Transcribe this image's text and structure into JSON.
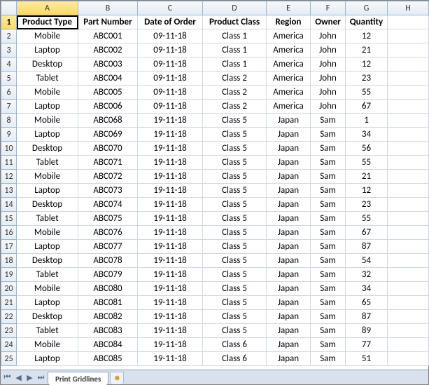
{
  "columns": [
    "A",
    "B",
    "C",
    "D",
    "E",
    "F",
    "G",
    "H"
  ],
  "active_column": "A",
  "active_row": 1,
  "headers": [
    "Product Type",
    "Part Number",
    "Date of Order",
    "Product Class",
    "Region",
    "Owner",
    "Quantity"
  ],
  "rows": [
    {
      "n": 1
    },
    {
      "n": 2,
      "c": [
        "Mobile",
        "ABC001",
        "09-11-18",
        "Class 1",
        "America",
        "John",
        "12"
      ]
    },
    {
      "n": 3,
      "c": [
        "Laptop",
        "ABC002",
        "09-11-18",
        "Class 1",
        "America",
        "John",
        "21"
      ]
    },
    {
      "n": 4,
      "c": [
        "Desktop",
        "ABC003",
        "09-11-18",
        "Class 1",
        "America",
        "John",
        "12"
      ]
    },
    {
      "n": 5,
      "c": [
        "Tablet",
        "ABC004",
        "09-11-18",
        "Class 2",
        "America",
        "John",
        "23"
      ]
    },
    {
      "n": 6,
      "c": [
        "Mobile",
        "ABC005",
        "09-11-18",
        "Class 2",
        "America",
        "John",
        "55"
      ]
    },
    {
      "n": 7,
      "c": [
        "Laptop",
        "ABC006",
        "09-11-18",
        "Class 2",
        "America",
        "John",
        "67"
      ]
    },
    {
      "n": 8,
      "c": [
        "Mobile",
        "ABC068",
        "19-11-18",
        "Class 5",
        "Japan",
        "Sam",
        "1"
      ]
    },
    {
      "n": 9,
      "c": [
        "Laptop",
        "ABC069",
        "19-11-18",
        "Class 5",
        "Japan",
        "Sam",
        "34"
      ]
    },
    {
      "n": 10,
      "c": [
        "Desktop",
        "ABC070",
        "19-11-18",
        "Class 5",
        "Japan",
        "Sam",
        "56"
      ]
    },
    {
      "n": 11,
      "c": [
        "Tablet",
        "ABC071",
        "19-11-18",
        "Class 5",
        "Japan",
        "Sam",
        "55"
      ]
    },
    {
      "n": 12,
      "c": [
        "Mobile",
        "ABC072",
        "19-11-18",
        "Class 5",
        "Japan",
        "Sam",
        "21"
      ]
    },
    {
      "n": 13,
      "c": [
        "Laptop",
        "ABC073",
        "19-11-18",
        "Class 5",
        "Japan",
        "Sam",
        "12"
      ]
    },
    {
      "n": 14,
      "c": [
        "Desktop",
        "ABC074",
        "19-11-18",
        "Class 5",
        "Japan",
        "Sam",
        "23"
      ]
    },
    {
      "n": 15,
      "c": [
        "Tablet",
        "ABC075",
        "19-11-18",
        "Class 5",
        "Japan",
        "Sam",
        "55"
      ]
    },
    {
      "n": 16,
      "c": [
        "Mobile",
        "ABC076",
        "19-11-18",
        "Class 5",
        "Japan",
        "Sam",
        "67"
      ]
    },
    {
      "n": 17,
      "c": [
        "Laptop",
        "ABC077",
        "19-11-18",
        "Class 5",
        "Japan",
        "Sam",
        "87"
      ]
    },
    {
      "n": 18,
      "c": [
        "Desktop",
        "ABC078",
        "19-11-18",
        "Class 5",
        "Japan",
        "Sam",
        "54"
      ]
    },
    {
      "n": 19,
      "c": [
        "Tablet",
        "ABC079",
        "19-11-18",
        "Class 5",
        "Japan",
        "Sam",
        "32"
      ]
    },
    {
      "n": 20,
      "c": [
        "Mobile",
        "ABC080",
        "19-11-18",
        "Class 5",
        "Japan",
        "Sam",
        "34"
      ]
    },
    {
      "n": 21,
      "c": [
        "Laptop",
        "ABC081",
        "19-11-18",
        "Class 5",
        "Japan",
        "Sam",
        "65"
      ]
    },
    {
      "n": 22,
      "c": [
        "Desktop",
        "ABC082",
        "19-11-18",
        "Class 5",
        "Japan",
        "Sam",
        "87"
      ]
    },
    {
      "n": 23,
      "c": [
        "Tablet",
        "ABC083",
        "19-11-18",
        "Class 5",
        "Japan",
        "Sam",
        "89"
      ]
    },
    {
      "n": 24,
      "c": [
        "Mobile",
        "ABC084",
        "19-11-18",
        "Class 6",
        "Japan",
        "Sam",
        "77"
      ]
    },
    {
      "n": 25,
      "c": [
        "Laptop",
        "ABC085",
        "19-11-18",
        "Class 6",
        "Japan",
        "Sam",
        "51"
      ]
    }
  ],
  "sheet_tab": {
    "name": "Print Gridlines",
    "active": true
  },
  "nav_icons": {
    "first": "⏮",
    "prev": "◀",
    "next": "▶",
    "last": "⏭"
  },
  "insert_sheet_icon": "✸",
  "chart_data": {
    "type": "table",
    "columns": [
      "Product Type",
      "Part Number",
      "Date of Order",
      "Product Class",
      "Region",
      "Owner",
      "Quantity"
    ],
    "data": [
      [
        "Mobile",
        "ABC001",
        "09-11-18",
        "Class 1",
        "America",
        "John",
        12
      ],
      [
        "Laptop",
        "ABC002",
        "09-11-18",
        "Class 1",
        "America",
        "John",
        21
      ],
      [
        "Desktop",
        "ABC003",
        "09-11-18",
        "Class 1",
        "America",
        "John",
        12
      ],
      [
        "Tablet",
        "ABC004",
        "09-11-18",
        "Class 2",
        "America",
        "John",
        23
      ],
      [
        "Mobile",
        "ABC005",
        "09-11-18",
        "Class 2",
        "America",
        "John",
        55
      ],
      [
        "Laptop",
        "ABC006",
        "09-11-18",
        "Class 2",
        "America",
        "John",
        67
      ],
      [
        "Mobile",
        "ABC068",
        "19-11-18",
        "Class 5",
        "Japan",
        "Sam",
        1
      ],
      [
        "Laptop",
        "ABC069",
        "19-11-18",
        "Class 5",
        "Japan",
        "Sam",
        34
      ],
      [
        "Desktop",
        "ABC070",
        "19-11-18",
        "Class 5",
        "Japan",
        "Sam",
        56
      ],
      [
        "Tablet",
        "ABC071",
        "19-11-18",
        "Class 5",
        "Japan",
        "Sam",
        55
      ],
      [
        "Mobile",
        "ABC072",
        "19-11-18",
        "Class 5",
        "Japan",
        "Sam",
        21
      ],
      [
        "Laptop",
        "ABC073",
        "19-11-18",
        "Class 5",
        "Japan",
        "Sam",
        12
      ],
      [
        "Desktop",
        "ABC074",
        "19-11-18",
        "Class 5",
        "Japan",
        "Sam",
        23
      ],
      [
        "Tablet",
        "ABC075",
        "19-11-18",
        "Class 5",
        "Japan",
        "Sam",
        55
      ],
      [
        "Mobile",
        "ABC076",
        "19-11-18",
        "Class 5",
        "Japan",
        "Sam",
        67
      ],
      [
        "Laptop",
        "ABC077",
        "19-11-18",
        "Class 5",
        "Japan",
        "Sam",
        87
      ],
      [
        "Desktop",
        "ABC078",
        "19-11-18",
        "Class 5",
        "Japan",
        "Sam",
        54
      ],
      [
        "Tablet",
        "ABC079",
        "19-11-18",
        "Class 5",
        "Japan",
        "Sam",
        32
      ],
      [
        "Mobile",
        "ABC080",
        "19-11-18",
        "Class 5",
        "Japan",
        "Sam",
        34
      ],
      [
        "Laptop",
        "ABC081",
        "19-11-18",
        "Class 5",
        "Japan",
        "Sam",
        65
      ],
      [
        "Desktop",
        "ABC082",
        "19-11-18",
        "Class 5",
        "Japan",
        "Sam",
        87
      ],
      [
        "Tablet",
        "ABC083",
        "19-11-18",
        "Class 5",
        "Japan",
        "Sam",
        89
      ],
      [
        "Mobile",
        "ABC084",
        "19-11-18",
        "Class 6",
        "Japan",
        "Sam",
        77
      ],
      [
        "Laptop",
        "ABC085",
        "19-11-18",
        "Class 6",
        "Japan",
        "Sam",
        51
      ]
    ]
  }
}
